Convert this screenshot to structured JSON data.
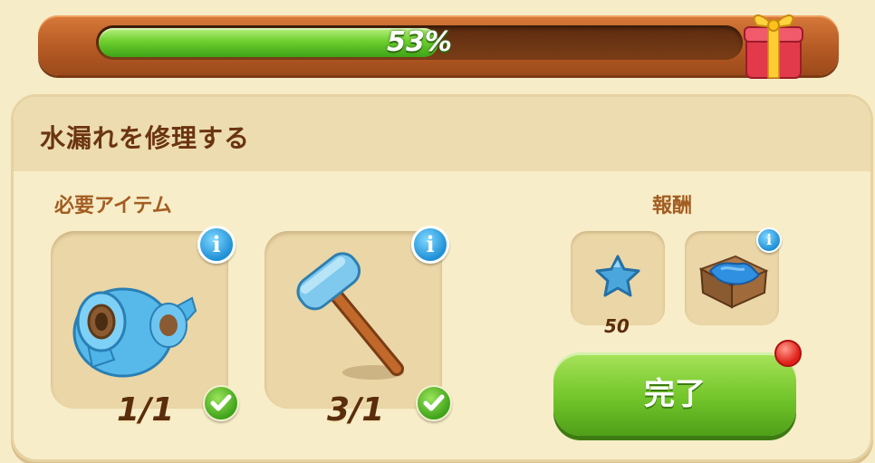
{
  "progress": {
    "percent_label": "53%",
    "fraction": 0.53
  },
  "task": {
    "title": "水漏れを修理する"
  },
  "required": {
    "label": "必要アイテム",
    "items": [
      {
        "name": "tape",
        "count": "1/1",
        "complete": true
      },
      {
        "name": "hammer",
        "count": "3/1",
        "complete": true
      }
    ]
  },
  "rewards": {
    "label": "報酬",
    "items": [
      {
        "name": "blue-star",
        "amount": "50"
      },
      {
        "name": "tarp-crate",
        "amount": ""
      }
    ]
  },
  "complete_button": {
    "label": "完了"
  },
  "icons": {
    "info": "i",
    "gift": "gift-box-icon",
    "check": "check-icon"
  },
  "colors": {
    "progress_fill": "#6fcf2e",
    "frame": "#b55a24",
    "title_text": "#6b3410",
    "button_green": "#72c52a",
    "info_blue": "#1f8fd6"
  }
}
